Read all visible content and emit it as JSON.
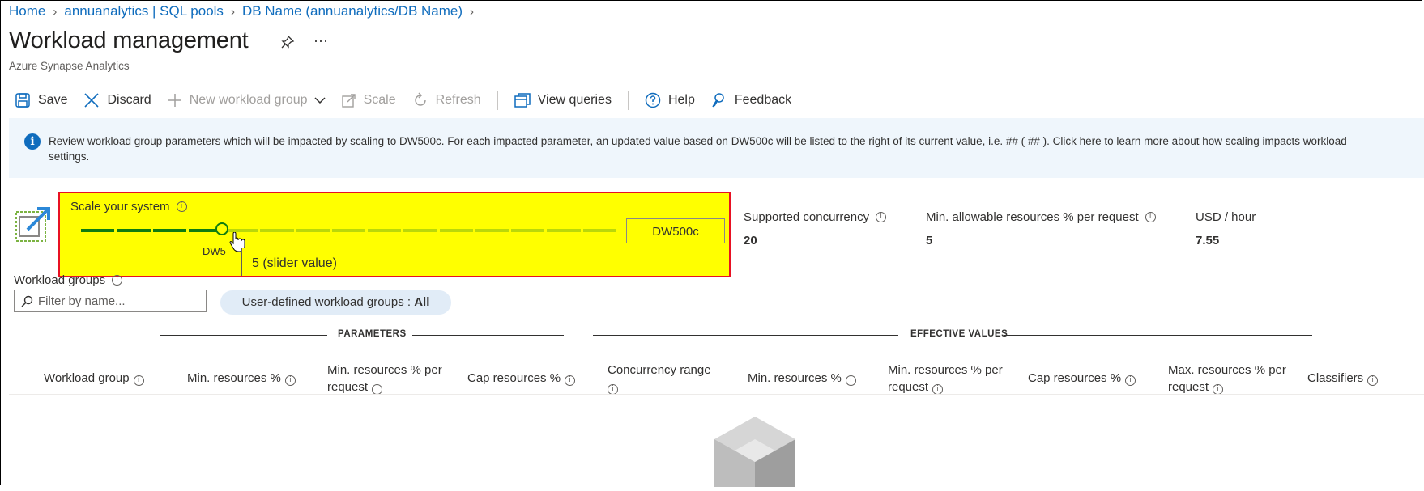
{
  "breadcrumb": [
    "Home",
    "annuanalytics | SQL pools",
    "DB Name (annuanalytics/DB Name)"
  ],
  "page": {
    "title": "Workload management",
    "subtitle": "Azure Synapse Analytics"
  },
  "toolbar": {
    "save": "Save",
    "discard": "Discard",
    "new_workload_group": "New workload group",
    "scale": "Scale",
    "refresh": "Refresh",
    "view_queries": "View queries",
    "help": "Help",
    "feedback": "Feedback"
  },
  "banner": {
    "line1": "Review workload group parameters which will be impacted by scaling to DW500c. For each impacted parameter, an updated value based on DW500c will be listed to the right of its current value, i.e. ## ( ## ). Click here to learn more about how scaling impacts workload",
    "line2": "settings."
  },
  "scale": {
    "label": "Scale your system",
    "slider_value": 5,
    "slider_min_label": "DW5",
    "tooltip": "5 (slider value)",
    "value": "DW500c"
  },
  "metrics": [
    {
      "label": "Supported concurrency",
      "value": "20"
    },
    {
      "label": "Min. allowable resources % per request",
      "value": "5"
    },
    {
      "label": "USD / hour",
      "value": "7.55"
    }
  ],
  "workload_groups": {
    "label": "Workload groups",
    "filter_placeholder": "Filter by name...",
    "pill_prefix": "User-defined workload groups : ",
    "pill_value": "All"
  },
  "sections": {
    "parameters": "PARAMETERS",
    "effective": "EFFECTIVE VALUES"
  },
  "columns": [
    {
      "line1": "Workload group",
      "line2": ""
    },
    {
      "line1": "Min. resources %",
      "line2": ""
    },
    {
      "line1": "Min. resources % per",
      "line2": "request"
    },
    {
      "line1": "Cap resources %",
      "line2": ""
    },
    {
      "line1": "Concurrency range",
      "line2": ""
    },
    {
      "line1": "Min. resources %",
      "line2": ""
    },
    {
      "line1": "Min. resources % per",
      "line2": "request"
    },
    {
      "line1": "Cap resources %",
      "line2": ""
    },
    {
      "line1": "Max. resources % per",
      "line2": "request"
    },
    {
      "line1": "Classifiers",
      "line2": ""
    }
  ],
  "colors": {
    "link": "#0f6cbd",
    "highlight": "#ffff00",
    "highlight_border": "#e81123",
    "slider_active": "#107c10",
    "slider_inactive": "#bad80a"
  }
}
